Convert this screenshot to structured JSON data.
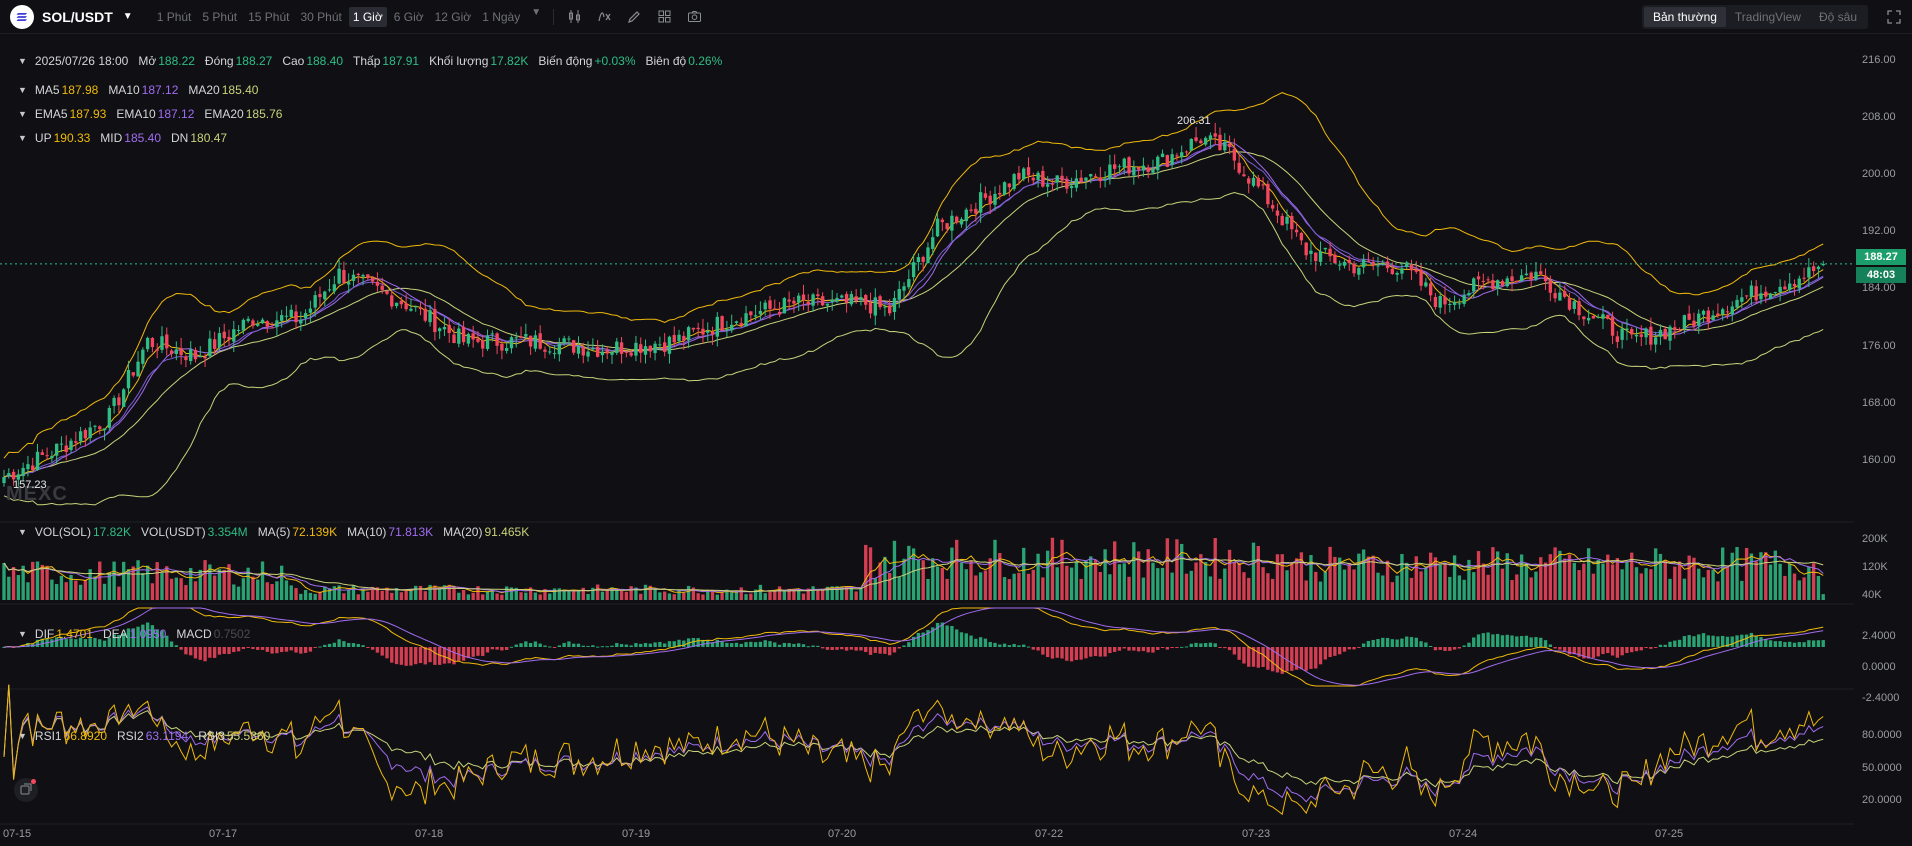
{
  "toolbar": {
    "pair": "SOL/USDT",
    "intervals": [
      "1 Phút",
      "5 Phút",
      "15 Phút",
      "30 Phút",
      "1 Giờ",
      "6 Giờ",
      "12 Giờ",
      "1 Ngày"
    ],
    "active_interval": "1 Giờ",
    "views": [
      "Bản thường",
      "TradingView",
      "Độ sâu"
    ],
    "active_view": "Bản thường"
  },
  "icons": {
    "logo": "solana-logo-icon",
    "caret": "chevron-down-icon",
    "tools": [
      "candlestick-type-icon",
      "indicator-fx-icon",
      "draw-pencil-icon",
      "layout-grid-icon",
      "camera-icon"
    ],
    "fullscreen": "fullscreen-icon",
    "settings": "settings-icon"
  },
  "ohlc": {
    "date": "2025/07/26 18:00",
    "open_label": "Mở",
    "open": "188.22",
    "close_label": "Đóng",
    "close": "188.27",
    "high_label": "Cao",
    "high": "188.40",
    "low_label": "Thấp",
    "low": "187.91",
    "volume_label": "Khối lượng",
    "volume": "17.82K",
    "change_label": "Biến động",
    "change": "+0.03%",
    "amplitude_label": "Biên độ",
    "amplitude": "0.26%"
  },
  "ma": {
    "ma5_label": "MA5",
    "ma5": "187.98",
    "ma10_label": "MA10",
    "ma10": "187.12",
    "ma20_label": "MA20",
    "ma20": "185.40"
  },
  "ema": {
    "ema5_label": "EMA5",
    "ema5": "187.93",
    "ema10_label": "EMA10",
    "ema10": "187.12",
    "ema20_label": "EMA20",
    "ema20": "185.76"
  },
  "boll": {
    "up_label": "UP",
    "up": "190.33",
    "mid_label": "MID",
    "mid": "185.40",
    "dn_label": "DN",
    "dn": "180.47"
  },
  "volume": {
    "vol_sol_label": "VOL(SOL)",
    "vol_sol": "17.82K",
    "vol_usdt_label": "VOL(USDT)",
    "vol_usdt": "3.354M",
    "ma5_label": "MA(5)",
    "ma5": "72.139K",
    "ma10_label": "MA(10)",
    "ma10": "71.813K",
    "ma20_label": "MA(20)",
    "ma20": "91.465K"
  },
  "macd": {
    "dif_label": "DIF",
    "dif": "1.4701",
    "dea_label": "DEA",
    "dea": "1.0950",
    "macd_label": "MACD",
    "macd": "0.7502"
  },
  "rsi": {
    "rsi1_label": "RSI1",
    "rsi1": "66.8920",
    "rsi2_label": "RSI2",
    "rsi2": "63.1194",
    "rsi3_label": "RSI3",
    "rsi3": "55.5360"
  },
  "axis": {
    "price_ticks": [
      "216.00",
      "208.00",
      "200.00",
      "192.00",
      "184.00",
      "176.00",
      "168.00",
      "160.00"
    ],
    "price_tick_values": [
      216,
      208,
      200,
      192,
      184,
      176,
      168,
      160
    ],
    "current_price": "188.27",
    "countdown": "48:03",
    "volume_ticks": [
      "200K",
      "120K",
      "40K"
    ],
    "macd_ticks": [
      "2.4000",
      "0.0000",
      "-2.4000"
    ],
    "rsi_ticks": [
      "80.0000",
      "50.0000",
      "20.0000"
    ],
    "dates": [
      "07-15",
      "07-17",
      "07-18",
      "07-19",
      "07-20",
      "07-22",
      "07-23",
      "07-24",
      "07-25"
    ]
  },
  "annotations": {
    "high": "206.31",
    "low": "157.23"
  },
  "watermark": "MEXC",
  "colors": {
    "up": "#2ebd85",
    "down": "#f6465d",
    "ma5": "#f0b90b",
    "ma10": "#a06cf0",
    "ma20": "#c9d27a",
    "boll_up": "#f0b90b",
    "boll_mid": "#a06cf0",
    "boll_dn": "#c9d27a",
    "background": "#101014"
  },
  "chart_data": {
    "type": "candlestick",
    "price_range": [
      154,
      218
    ],
    "anchors": [
      [
        0,
        160
      ],
      [
        12,
        164
      ],
      [
        22,
        168
      ],
      [
        30,
        178
      ],
      [
        40,
        176
      ],
      [
        52,
        181
      ],
      [
        62,
        181
      ],
      [
        70,
        187
      ],
      [
        84,
        183
      ],
      [
        96,
        178
      ],
      [
        110,
        178
      ],
      [
        125,
        177
      ],
      [
        140,
        178
      ],
      [
        152,
        181
      ],
      [
        165,
        183
      ],
      [
        180,
        183
      ],
      [
        185,
        182
      ],
      [
        195,
        193
      ],
      [
        205,
        197
      ],
      [
        212,
        200
      ],
      [
        220,
        199
      ],
      [
        232,
        201
      ],
      [
        242,
        202
      ],
      [
        250,
        205
      ],
      [
        256,
        203
      ],
      [
        265,
        196
      ],
      [
        272,
        190
      ],
      [
        282,
        188
      ],
      [
        292,
        188
      ],
      [
        300,
        183
      ],
      [
        310,
        186
      ],
      [
        320,
        187
      ],
      [
        330,
        182
      ],
      [
        340,
        178
      ],
      [
        350,
        180
      ],
      [
        360,
        183
      ],
      [
        368,
        185
      ],
      [
        377,
        187
      ],
      [
        380,
        188.27
      ]
    ],
    "candle_count": 381,
    "volume_range": [
      0,
      230
    ],
    "macd_range": [
      -3.0,
      3.0
    ],
    "rsi_range": [
      5,
      95
    ]
  }
}
